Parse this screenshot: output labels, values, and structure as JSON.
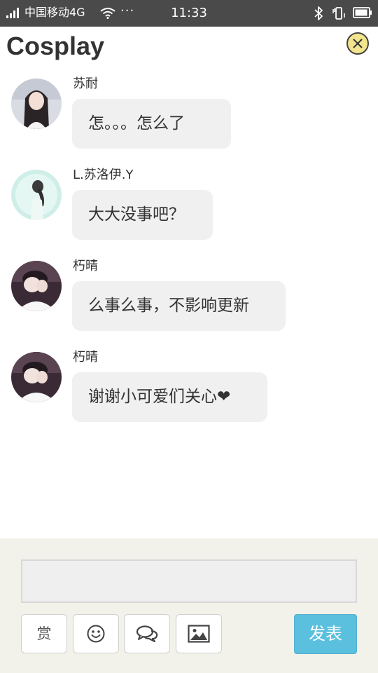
{
  "status_bar": {
    "carrier": "中国移动4G",
    "more": "···",
    "time": "11:33",
    "icons": [
      "signal-icon",
      "wifi-icon",
      "bluetooth-icon",
      "vibrate-icon",
      "battery-icon"
    ]
  },
  "header": {
    "title": "Cosplay",
    "close_icon": "close-icon",
    "accent_color": "#f3e58d"
  },
  "messages": [
    {
      "sender": "苏耐",
      "text": "怎。。。怎么了",
      "avatar": "avatar-girl-longhair"
    },
    {
      "sender": "L.苏洛伊.Y",
      "text": "大大没事吧？",
      "avatar": "avatar-braid-mint"
    },
    {
      "sender": "朽晴",
      "text": "么事么事，不影响更新",
      "avatar": "avatar-hands-face"
    },
    {
      "sender": "朽晴",
      "text": "谢谢小可爱们关心❤",
      "avatar": "avatar-hands-face"
    }
  ],
  "compose": {
    "input_value": "",
    "reward_label": "赏",
    "send_label": "发表",
    "send_color": "#5bc0de",
    "tool_icons": [
      "smiley-icon",
      "chat-bubbles-icon",
      "image-icon"
    ]
  }
}
